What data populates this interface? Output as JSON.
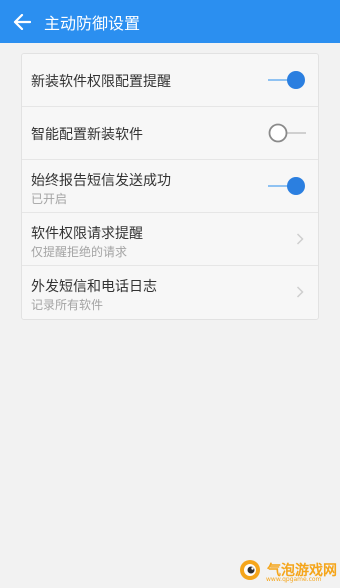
{
  "header": {
    "title": "主动防御设置",
    "color": "#2b8ff0"
  },
  "settings": [
    {
      "title": "新装软件权限配置提醒",
      "control": "toggle",
      "state": "on"
    },
    {
      "title": "智能配置新装软件",
      "control": "toggle",
      "state": "off"
    },
    {
      "title": "始终报告短信发送成功",
      "subtitle": "已开启",
      "control": "toggle",
      "state": "on"
    },
    {
      "title": "软件权限请求提醒",
      "subtitle": "仅提醒拒绝的请求",
      "control": "chevron"
    },
    {
      "title": "外发短信和电话日志",
      "subtitle": "记录所有软件",
      "control": "chevron"
    }
  ],
  "watermark": {
    "text": "气泡游戏网",
    "sub": "www.qpgame.com",
    "color": "#f5a51a"
  }
}
